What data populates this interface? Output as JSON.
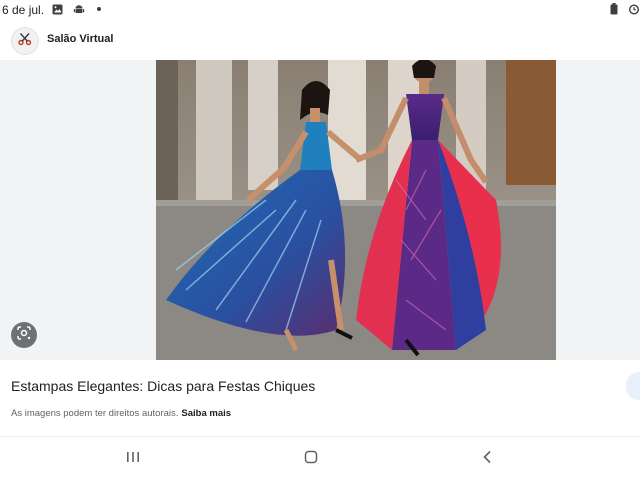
{
  "status_bar": {
    "time": "6 de jul.",
    "left_icons": [
      "image-icon",
      "android-icon",
      "dot-icon"
    ],
    "right_icons": [
      "battery-icon",
      "alarm-icon"
    ]
  },
  "header": {
    "site_name": "Salão Virtual",
    "logo_icon": "scissors-icon"
  },
  "image": {
    "alt": "Estampas Elegantes: Dicas para Festas Chiques"
  },
  "caption": {
    "title": "Estampas Elegantes: Dicas para Festas Chiques",
    "copyright_note": "As imagens podem ter direitos autorais.",
    "learn_more": "Saiba mais"
  },
  "nav": {
    "buttons": [
      "recents-icon",
      "home-icon",
      "back-icon"
    ]
  },
  "colors": {
    "accent": "#e8f0fe",
    "image_bg": "#f1f3f4",
    "text": "#202124",
    "muted": "#5f6368"
  }
}
